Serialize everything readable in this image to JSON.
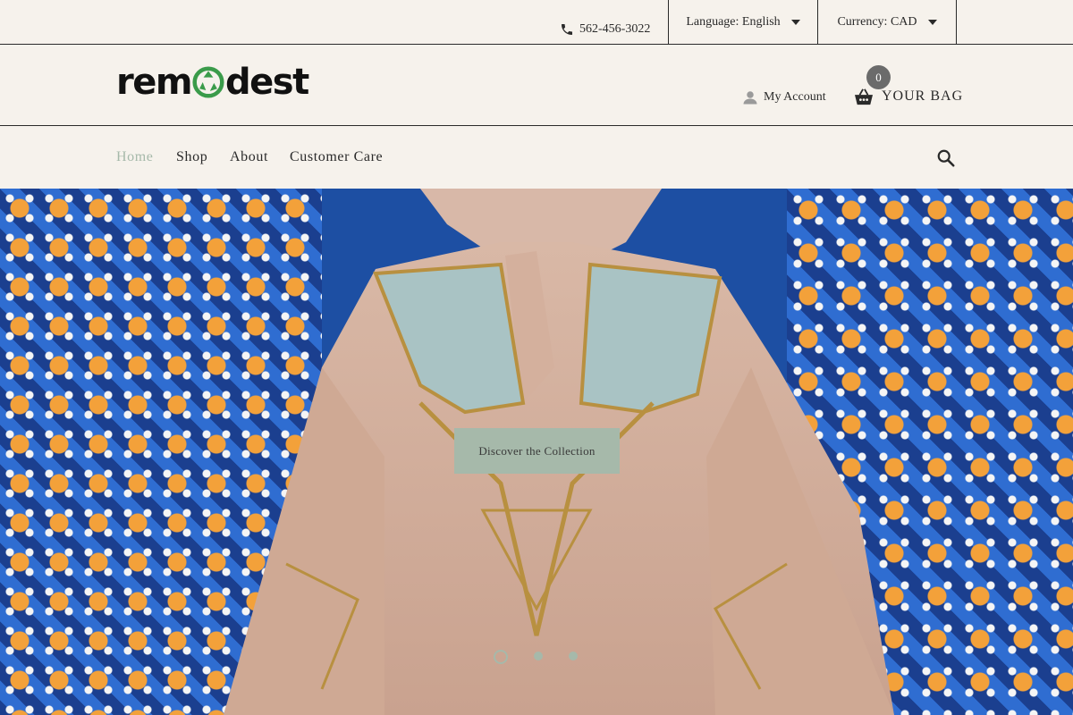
{
  "topbar": {
    "phone": "562-456-3022",
    "language_label": "Language: English",
    "currency_label": "Currency: CAD"
  },
  "header": {
    "logo_left": "rem",
    "logo_right": "dest",
    "account_label": "My Account",
    "bag_label": "YOUR BAG",
    "bag_count": "0"
  },
  "nav": {
    "items": [
      {
        "label": "Home",
        "active": true
      },
      {
        "label": "Shop",
        "active": false
      },
      {
        "label": "About",
        "active": false
      },
      {
        "label": "Customer Care",
        "active": false
      }
    ]
  },
  "hero": {
    "cta_label": "Discover the Collection",
    "slides_total": 3,
    "active_slide": 1
  },
  "colors": {
    "background": "#f6f2ec",
    "accent": "#a6b9aa",
    "text": "#2a2a2a",
    "recycle_green": "#3a9b4a"
  }
}
